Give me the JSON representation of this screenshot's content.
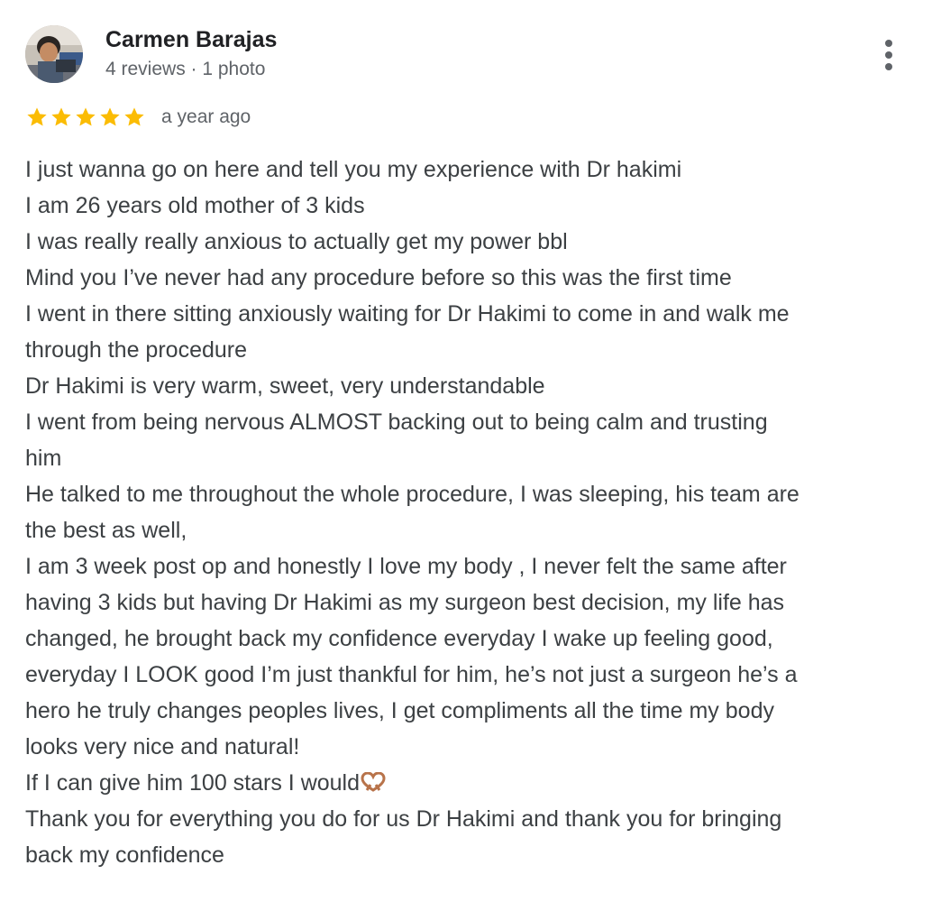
{
  "reviewer": {
    "name": "Carmen Barajas",
    "meta": "4 reviews · 1 photo",
    "avatar_icon": "profile-photo"
  },
  "rating": {
    "stars": 5,
    "max_stars": 5,
    "star_color": "#fbbc04",
    "date": "a year ago"
  },
  "menu": {
    "icon": "more-vertical-icon"
  },
  "review": {
    "lines": [
      "I just wanna go on here and tell you my experience with Dr hakimi",
      "I am 26 years old mother of 3 kids",
      "I was really really anxious to actually get my power bbl",
      "Mind you I’ve never had any procedure before so this was the first time",
      "I went in there sitting anxiously waiting for Dr Hakimi to come in and walk me",
      "through the procedure",
      "Dr Hakimi is very warm, sweet, very understandable",
      "I went from being nervous ALMOST backing out to being calm and trusting",
      "him",
      "He talked to me throughout the whole procedure, I was sleeping, his team are",
      "the best as well,",
      "I am 3 week post op and honestly I love my body , I never felt the same after",
      "having 3 kids but having Dr Hakimi as my surgeon best decision, my life has",
      "changed, he brought back my confidence everyday I wake up feeling good,",
      "everyday I LOOK good I’m just thankful for him, he’s not just a surgeon he’s a",
      "hero he truly changes peoples lives, I get compliments all the time my body",
      "looks very nice and natural!",
      "If I can give him 100 stars I would",
      "Thank you for everything you do for us Dr Hakimi and thank you for bringing",
      "back my confidence"
    ],
    "emoji_icon": "heart-hands-icon"
  }
}
